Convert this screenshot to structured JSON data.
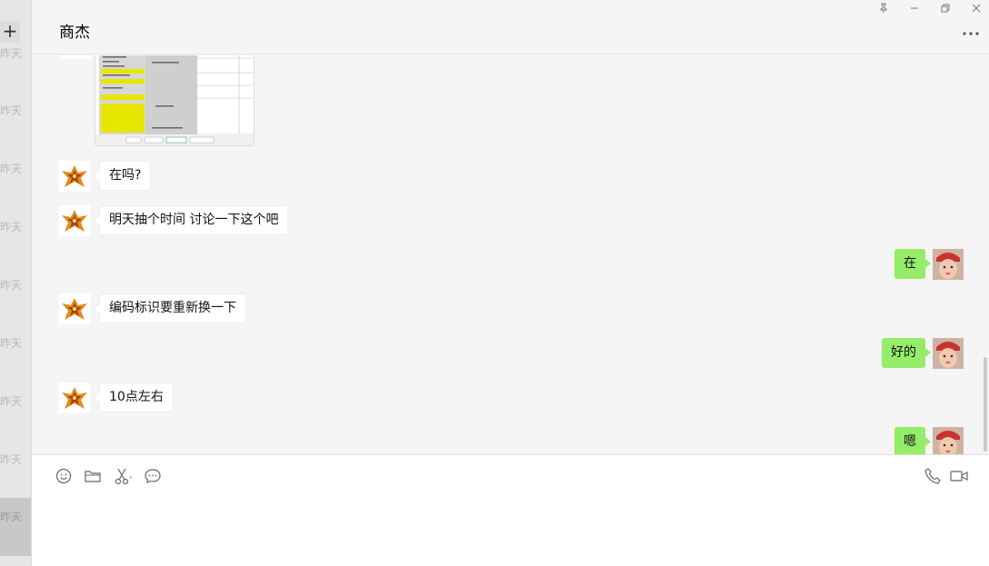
{
  "left_strip": {
    "add_label": "+",
    "day_labels": [
      "昨天",
      "昨天",
      "昨天",
      "昨天",
      "昨天",
      "昨天",
      "昨天",
      "昨天",
      "昨天"
    ]
  },
  "window": {
    "pin_icon": "pin-icon",
    "minimize_icon": "minimize-icon",
    "restore_icon": "restore-icon",
    "close_icon": "close-icon"
  },
  "header": {
    "title": "商杰",
    "more_icon": "more-dots-icon"
  },
  "messages": [
    {
      "side": "in",
      "type": "image",
      "content": "spreadsheet-screenshot"
    },
    {
      "side": "in",
      "text": "在吗?"
    },
    {
      "side": "in",
      "text": "明天抽个时间 讨论一下这个吧"
    },
    {
      "side": "out",
      "text": "在"
    },
    {
      "side": "in",
      "text": "编码标识要重新换一下"
    },
    {
      "side": "out",
      "text": "好的"
    },
    {
      "side": "in",
      "text": "10点左右"
    },
    {
      "side": "out",
      "text": "嗯"
    }
  ],
  "toolbar": {
    "left_tools": [
      "emoji-icon",
      "folder-icon",
      "scissors-icon",
      "chat-history-icon"
    ],
    "right_tools": [
      "phone-icon",
      "video-icon"
    ]
  },
  "input": {
    "value": ""
  },
  "colors": {
    "outgoing_bubble": "#95ec69",
    "incoming_bubble": "#ffffff",
    "background": "#f5f5f5",
    "highlight_yellow": "#e6e600"
  }
}
